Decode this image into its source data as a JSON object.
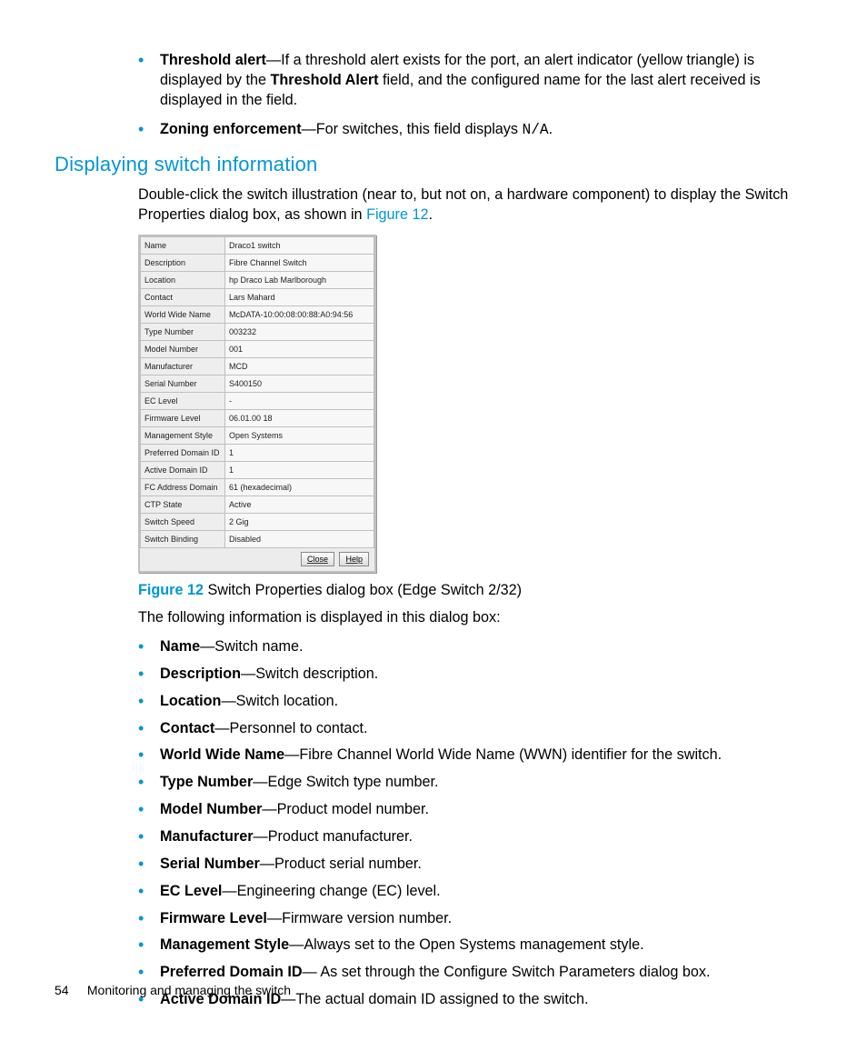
{
  "top_bullets": [
    {
      "term": "Threshold alert",
      "text_before": "—If a threshold alert exists for the port, an alert indicator (yellow triangle) is displayed by the ",
      "bold_mid": "Threshold Alert",
      "text_after": " field, and the configured name for the last alert received is displayed in the field."
    },
    {
      "term": "Zoning enforcement",
      "text_before": "—For switches, this field displays ",
      "mono": "N/A",
      "text_after": "."
    }
  ],
  "heading": "Displaying switch information",
  "intro_before_link": "Double-click the switch illustration (near to, but not on, a hardware component) to display the Switch Properties dialog box, as shown in ",
  "intro_link": "Figure 12",
  "intro_after_link": ".",
  "dialog": {
    "rows": [
      {
        "label": "Name",
        "value": "Draco1 switch"
      },
      {
        "label": "Description",
        "value": "Fibre Channel Switch"
      },
      {
        "label": "Location",
        "value": "hp Draco Lab Marlborough"
      },
      {
        "label": "Contact",
        "value": "Lars Mahard"
      },
      {
        "label": "World Wide Name",
        "value": "McDATA-10:00:08:00:88:A0:94:56"
      },
      {
        "label": "Type Number",
        "value": "003232"
      },
      {
        "label": "Model Number",
        "value": "001"
      },
      {
        "label": "Manufacturer",
        "value": "MCD"
      },
      {
        "label": "Serial Number",
        "value": "S400150"
      },
      {
        "label": "EC Level",
        "value": "-"
      },
      {
        "label": "Firmware Level",
        "value": "06.01.00 18"
      },
      {
        "label": "Management Style",
        "value": "Open Systems"
      },
      {
        "label": "Preferred Domain ID",
        "value": "1"
      },
      {
        "label": "Active Domain ID",
        "value": "1"
      },
      {
        "label": "FC Address Domain",
        "value": "61 (hexadecimal)"
      },
      {
        "label": "CTP State",
        "value": "Active"
      },
      {
        "label": "Switch Speed",
        "value": "2 Gig"
      },
      {
        "label": "Switch Binding",
        "value": "Disabled"
      }
    ],
    "buttons": {
      "close": "Close",
      "help": "Help"
    }
  },
  "figure": {
    "num": "Figure 12",
    "caption": " Switch Properties dialog box (Edge Switch 2/32)"
  },
  "after_fig": "The following information is displayed in this dialog box:",
  "definitions": [
    {
      "term": "Name",
      "desc": "—Switch name."
    },
    {
      "term": "Description",
      "desc": "—Switch description."
    },
    {
      "term": "Location",
      "desc": "—Switch location."
    },
    {
      "term": "Contact",
      "desc": "—Personnel to contact."
    },
    {
      "term": "World Wide Name",
      "desc": "—Fibre Channel World Wide Name (WWN) identifier for the switch."
    },
    {
      "term": "Type Number",
      "desc": "—Edge Switch type number."
    },
    {
      "term": "Model Number",
      "desc": "—Product model number."
    },
    {
      "term": "Manufacturer",
      "desc": "—Product manufacturer."
    },
    {
      "term": "Serial Number",
      "desc": "—Product serial number."
    },
    {
      "term": "EC Level",
      "desc": "—Engineering change (EC) level."
    },
    {
      "term": "Firmware Level",
      "desc": "—Firmware version number."
    },
    {
      "term": "Management Style",
      "desc": "—Always set to the Open Systems management style."
    },
    {
      "term": "Preferred Domain ID",
      "desc": "— As set through the Configure Switch Parameters dialog box."
    },
    {
      "term": "Active Domain ID",
      "desc": "—The actual domain ID assigned to the switch."
    }
  ],
  "footer": {
    "page": "54",
    "title": "Monitoring and managing the switch"
  }
}
